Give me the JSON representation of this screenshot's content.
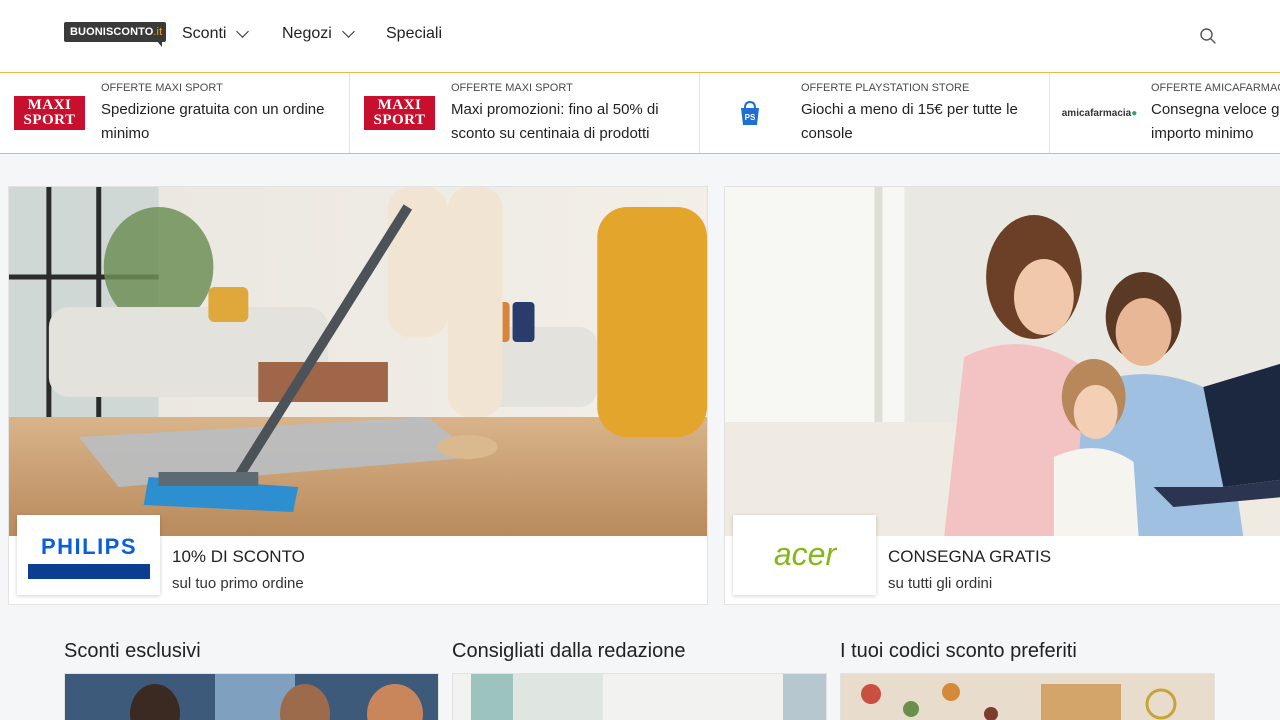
{
  "header": {
    "logo_text": "BUONISCONTO",
    "logo_tld": ".it",
    "nav": [
      {
        "label": "Sconti",
        "has_dropdown": true
      },
      {
        "label": "Negozi",
        "has_dropdown": true
      },
      {
        "label": "Speciali",
        "has_dropdown": false
      }
    ],
    "search_icon": "search-icon"
  },
  "offers": [
    {
      "logo_text": "MAXI SPORT",
      "category": "OFFERTE MAXI SPORT",
      "title": "Spedizione gratuita con un ordine minimo"
    },
    {
      "logo_text": "MAXI SPORT",
      "category": "OFFERTE MAXI SPORT",
      "title": "Maxi promozioni: fino al 50% di sconto su centinaia di prodotti"
    },
    {
      "logo_icon": "playstation-bag-icon",
      "category": "OFFERTE PLAYSTATION STORE",
      "title": "Giochi a meno di 15€ per tutte le console"
    },
    {
      "logo_text": "amicafarmacia",
      "category": "OFFERTE AMICAFARMACIA",
      "title": "Consegna veloce gratis senza importo minimo"
    }
  ],
  "hero_cards": [
    {
      "brand": "PHILIPS",
      "title": "10% DI SCONTO",
      "subtitle": "sul tuo primo ordine"
    },
    {
      "brand": "acer",
      "title": "CONSEGNA GRATIS",
      "subtitle": "su tutti gli ordini"
    }
  ],
  "sections": [
    {
      "title": "Sconti esclusivi"
    },
    {
      "title": "Consigliati dalla redazione"
    },
    {
      "title": "I tuoi codici sconto preferiti"
    }
  ],
  "colors": {
    "accent_border": "#f0b74a",
    "maxi_sport_red": "#c8102e",
    "philips_blue": "#0b5ed7",
    "acer_green": "#83b81a"
  }
}
